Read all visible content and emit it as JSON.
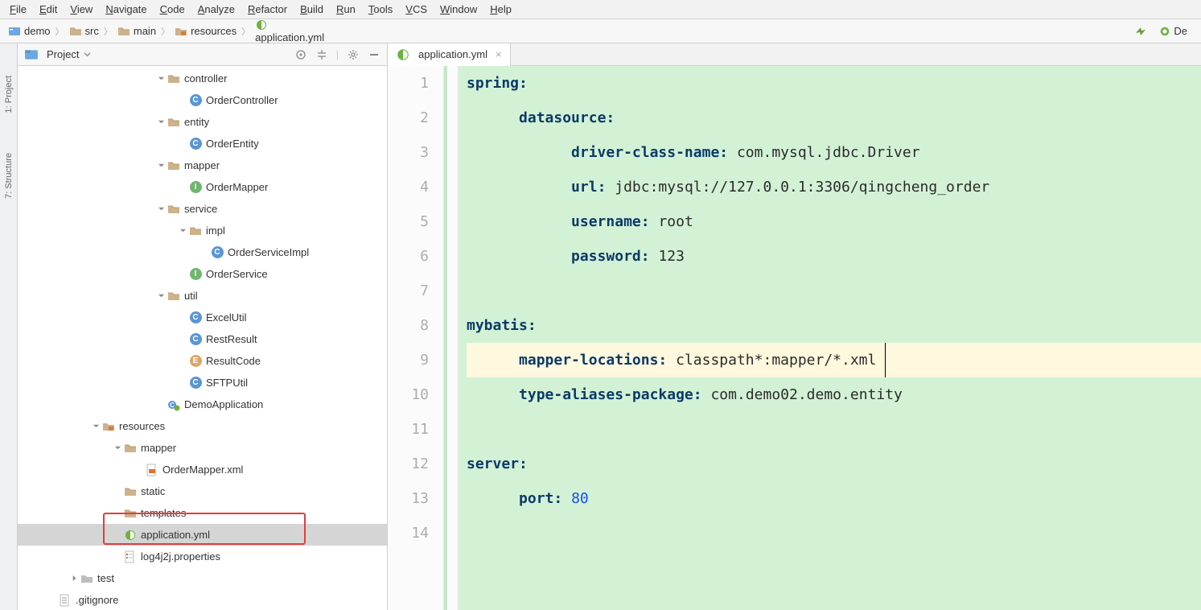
{
  "menu": [
    "File",
    "Edit",
    "View",
    "Navigate",
    "Code",
    "Analyze",
    "Refactor",
    "Build",
    "Run",
    "Tools",
    "VCS",
    "Window",
    "Help"
  ],
  "breadcrumb": [
    {
      "icon": "proj",
      "label": "demo"
    },
    {
      "icon": "folder",
      "label": "src"
    },
    {
      "icon": "folder",
      "label": "main"
    },
    {
      "icon": "resfolder",
      "label": "resources"
    },
    {
      "icon": "spring",
      "label": "application.yml"
    }
  ],
  "bc_right_label": "De",
  "panel": {
    "title": "Project"
  },
  "left_tabs": [
    "1: Project",
    "7: Structure"
  ],
  "tree": [
    {
      "d": 7,
      "tw": "down",
      "ic": "folder",
      "l": "controller"
    },
    {
      "d": 8,
      "tw": "",
      "ic": "c",
      "l": "OrderController"
    },
    {
      "d": 7,
      "tw": "down",
      "ic": "folder",
      "l": "entity"
    },
    {
      "d": 8,
      "tw": "",
      "ic": "c",
      "l": "OrderEntity"
    },
    {
      "d": 7,
      "tw": "down",
      "ic": "folder",
      "l": "mapper"
    },
    {
      "d": 8,
      "tw": "",
      "ic": "i",
      "l": "OrderMapper"
    },
    {
      "d": 7,
      "tw": "down",
      "ic": "folder",
      "l": "service"
    },
    {
      "d": 8,
      "tw": "down",
      "ic": "folder",
      "l": "impl"
    },
    {
      "d": 9,
      "tw": "",
      "ic": "c",
      "l": "OrderServiceImpl"
    },
    {
      "d": 8,
      "tw": "",
      "ic": "i",
      "l": "OrderService"
    },
    {
      "d": 7,
      "tw": "down",
      "ic": "folder",
      "l": "util"
    },
    {
      "d": 8,
      "tw": "",
      "ic": "c",
      "l": "ExcelUtil"
    },
    {
      "d": 8,
      "tw": "",
      "ic": "c",
      "l": "RestResult"
    },
    {
      "d": 8,
      "tw": "",
      "ic": "e",
      "l": "ResultCode"
    },
    {
      "d": 8,
      "tw": "",
      "ic": "c",
      "l": "SFTPUtil"
    },
    {
      "d": 7,
      "tw": "",
      "ic": "spring-c",
      "l": "DemoApplication"
    },
    {
      "d": 4,
      "tw": "down",
      "ic": "resfolder",
      "l": "resources"
    },
    {
      "d": 5,
      "tw": "down",
      "ic": "folder",
      "l": "mapper"
    },
    {
      "d": 6,
      "tw": "",
      "ic": "xml",
      "l": "OrderMapper.xml"
    },
    {
      "d": 5,
      "tw": "",
      "ic": "folder",
      "l": "static"
    },
    {
      "d": 5,
      "tw": "",
      "ic": "folder",
      "l": "templates"
    },
    {
      "d": 5,
      "tw": "",
      "ic": "spring",
      "l": "application.yml",
      "sel": true,
      "box": true
    },
    {
      "d": 5,
      "tw": "",
      "ic": "prop",
      "l": "log4j2j.properties"
    },
    {
      "d": 3,
      "tw": "right",
      "ic": "folder-grey",
      "l": "test"
    },
    {
      "d": 2,
      "tw": "",
      "ic": "gitignore",
      "l": ".gitignore"
    }
  ],
  "tab": {
    "label": "application.yml"
  },
  "code": [
    {
      "n": 1,
      "t": [
        [
          "kw",
          "spring"
        ],
        [
          "kw",
          ":"
        ]
      ]
    },
    {
      "n": 2,
      "t": [
        [
          "sp",
          "  "
        ],
        [
          "kw",
          "datasource"
        ],
        [
          "kw",
          ":"
        ]
      ]
    },
    {
      "n": 3,
      "t": [
        [
          "sp",
          "    "
        ],
        [
          "kw",
          "driver-class-name"
        ],
        [
          "kw",
          ": "
        ],
        [
          "val",
          "com.mysql.jdbc.Driver"
        ]
      ]
    },
    {
      "n": 4,
      "t": [
        [
          "sp",
          "    "
        ],
        [
          "kw",
          "url"
        ],
        [
          "kw",
          ": "
        ],
        [
          "val",
          "jdbc:mysql://127.0.0.1:3306/qingcheng_order"
        ]
      ]
    },
    {
      "n": 5,
      "t": [
        [
          "sp",
          "    "
        ],
        [
          "kw",
          "username"
        ],
        [
          "kw",
          ": "
        ],
        [
          "val",
          "root"
        ]
      ]
    },
    {
      "n": 6,
      "t": [
        [
          "sp",
          "    "
        ],
        [
          "kw",
          "password"
        ],
        [
          "kw",
          ": "
        ],
        [
          "val",
          "123"
        ]
      ]
    },
    {
      "n": 7,
      "t": []
    },
    {
      "n": 8,
      "t": [
        [
          "kw",
          "mybatis"
        ],
        [
          "kw",
          ":"
        ]
      ]
    },
    {
      "n": 9,
      "hl": true,
      "t": [
        [
          "sp",
          "  "
        ],
        [
          "kw",
          "mapper-locations"
        ],
        [
          "kw",
          ": "
        ],
        [
          "val",
          "classpath*:mapper/*.xml"
        ],
        [
          "caret",
          ""
        ]
      ]
    },
    {
      "n": 10,
      "t": [
        [
          "sp",
          "  "
        ],
        [
          "kw",
          "type-aliases-package"
        ],
        [
          "kw",
          ": "
        ],
        [
          "val",
          "com.demo02.demo.entity"
        ]
      ]
    },
    {
      "n": 11,
      "t": []
    },
    {
      "n": 12,
      "t": [
        [
          "kw",
          "server"
        ],
        [
          "kw",
          ":"
        ]
      ]
    },
    {
      "n": 13,
      "t": [
        [
          "sp",
          "  "
        ],
        [
          "kw",
          "port"
        ],
        [
          "kw",
          ": "
        ],
        [
          "num",
          "80"
        ]
      ]
    },
    {
      "n": 14,
      "t": []
    }
  ]
}
